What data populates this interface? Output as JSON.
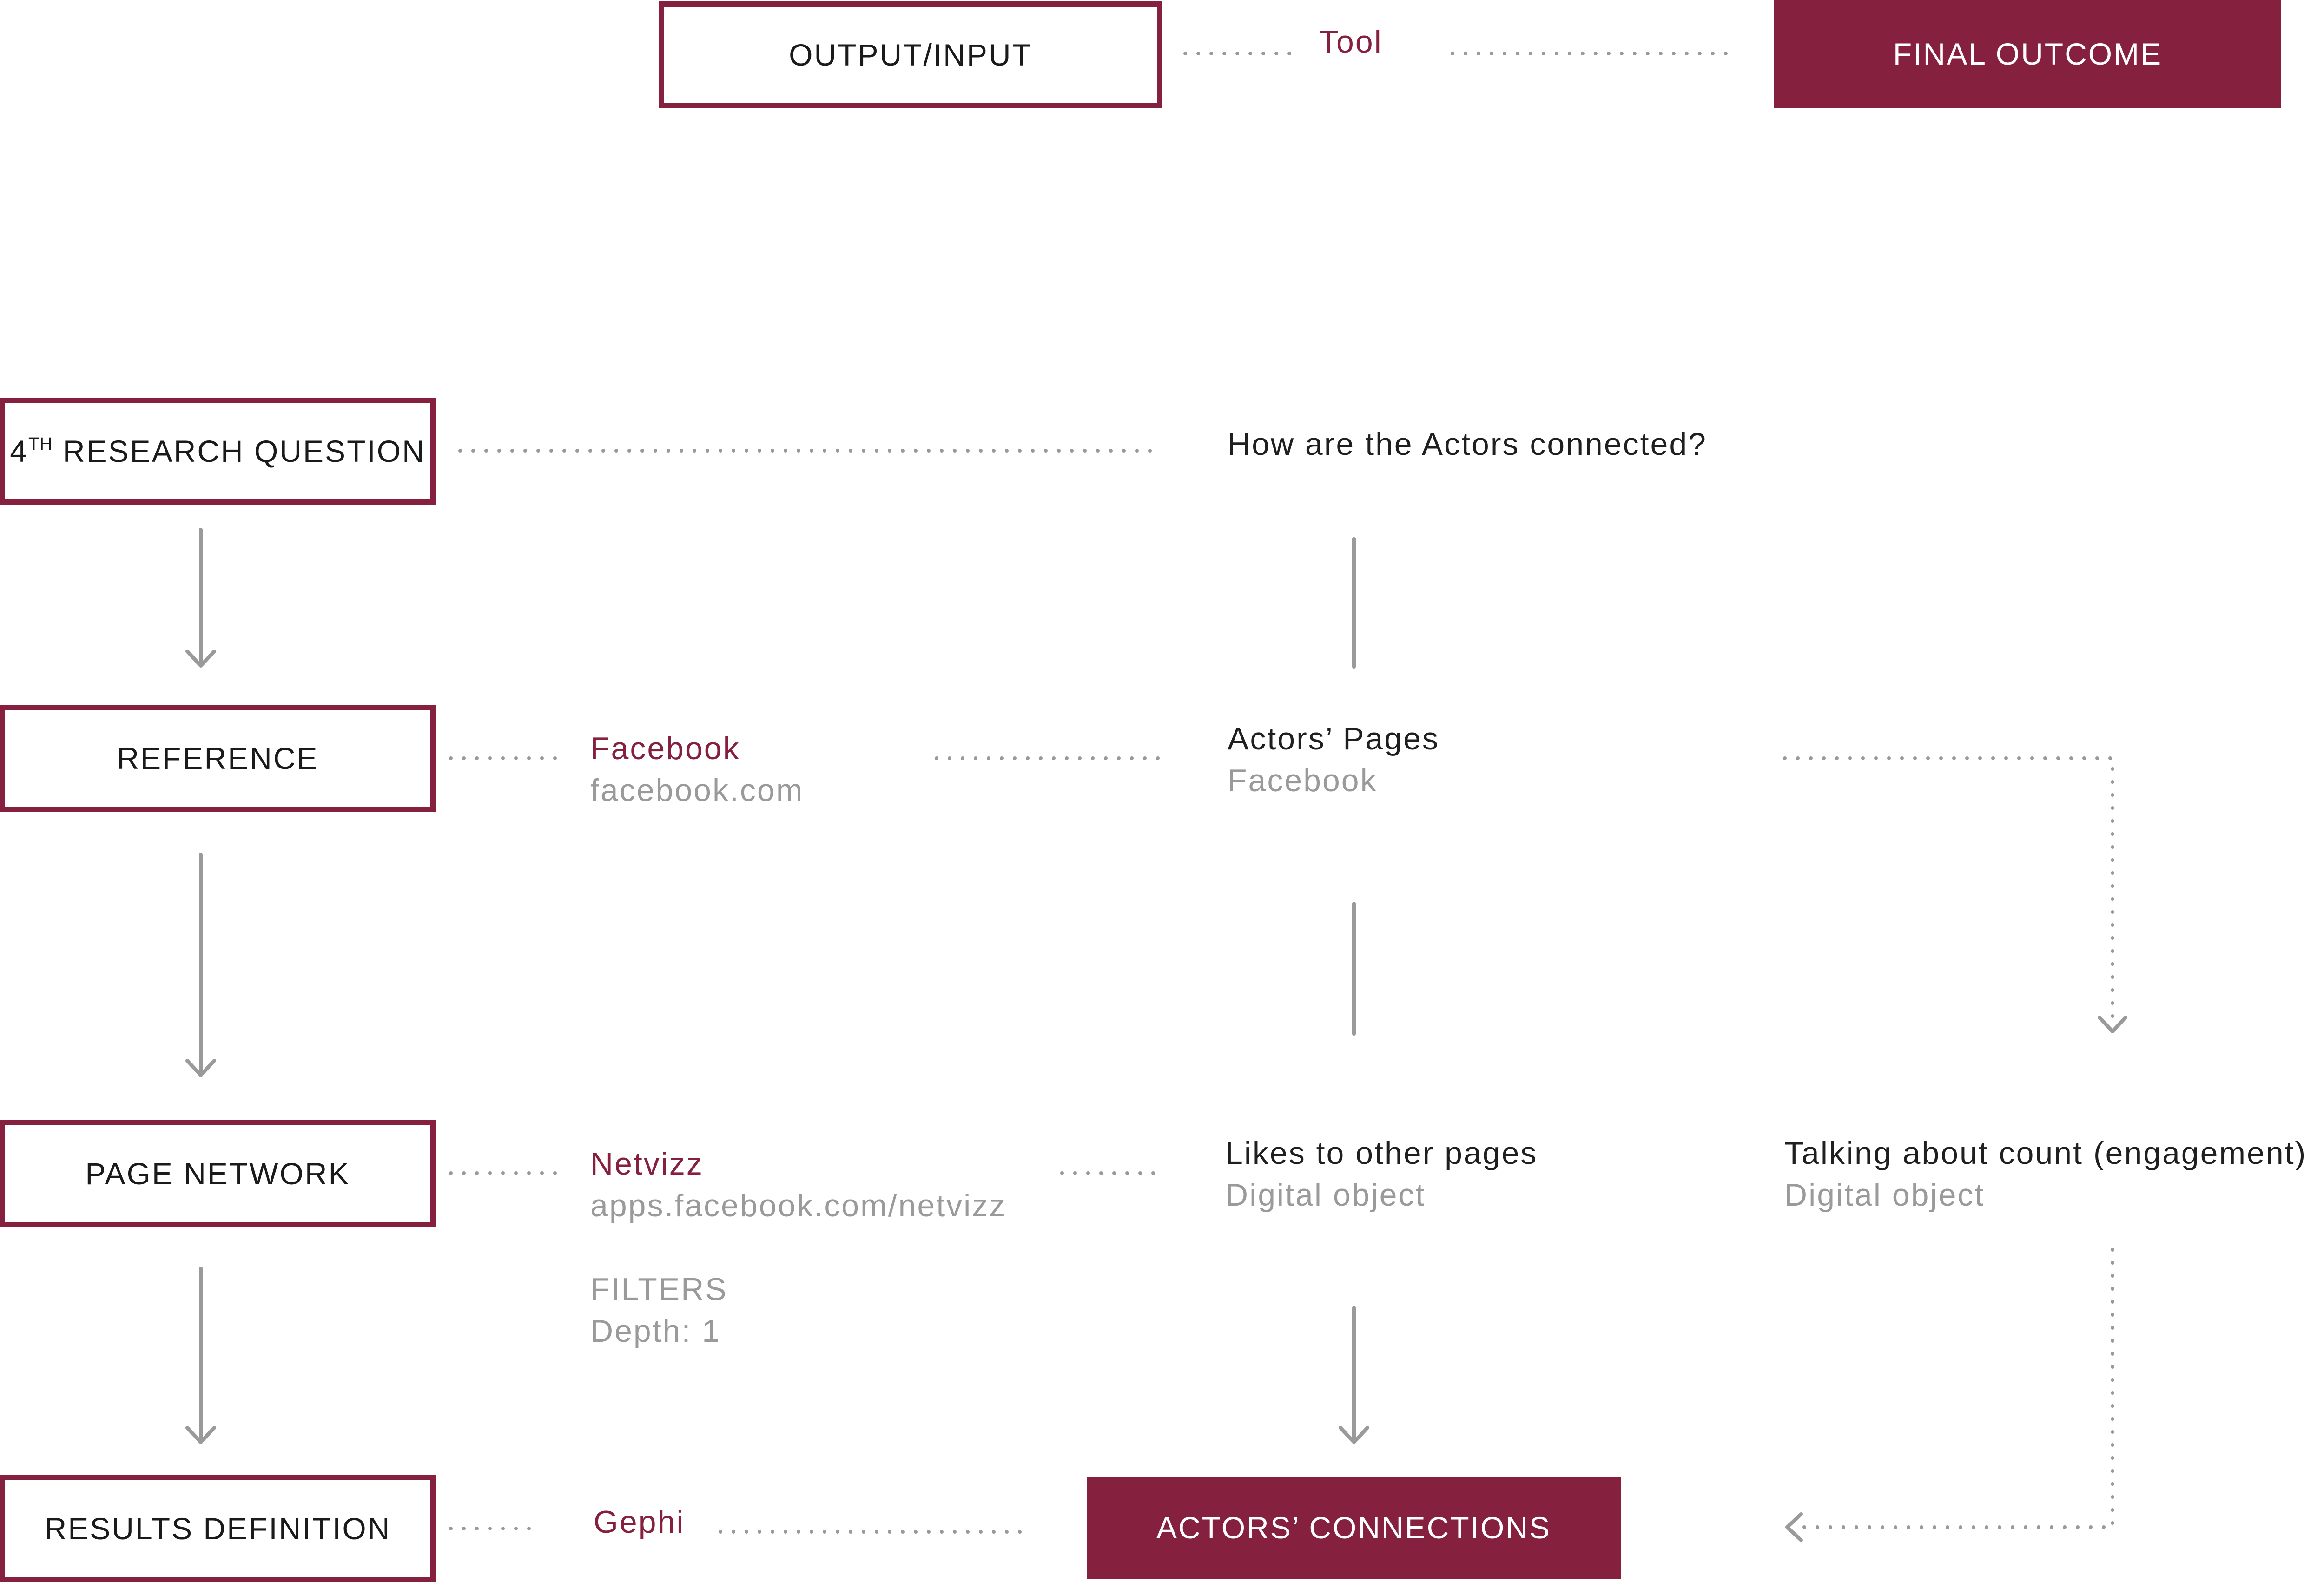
{
  "legend": {
    "box_label": "OUTPUT/INPUT",
    "tool_label": "Tool",
    "outcome_label": "FINAL OUTCOME"
  },
  "steps": {
    "question_prefix": "4",
    "question_sup": "TH",
    "question_rest": " RESEARCH QUESTION",
    "reference": "REFERENCE",
    "page_network": "PAGE NETWORK",
    "results_definition": "RESULTS DEFINITION"
  },
  "tools": {
    "facebook": {
      "name": "Facebook",
      "url": "facebook.com"
    },
    "netvizz": {
      "name": "Netvizz",
      "url": "apps.facebook.com/netvizz",
      "filters_label": "FILTERS",
      "filters_value": "Depth: 1"
    },
    "gephi": {
      "name": "Gephi"
    }
  },
  "objects": {
    "question_text": "How are the Actors connected?",
    "actors_pages": {
      "title": "Actors’ Pages",
      "subtitle": "Facebook"
    },
    "likes": {
      "title": "Likes to other pages",
      "subtitle": "Digital object"
    },
    "talking": {
      "title": "Talking about count (engagement)",
      "subtitle": "Digital object"
    }
  },
  "outcome": {
    "label": "ACTORS’ CONNECTIONS"
  },
  "colors": {
    "accent": "#85203f",
    "line": "#9a9a9a",
    "text": "#1f1f1f",
    "muted": "#9a9a9a"
  }
}
